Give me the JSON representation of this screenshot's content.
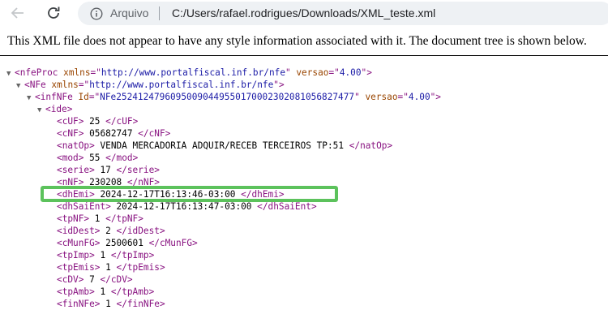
{
  "toolbar": {
    "site_label": "Arquivo",
    "url": "C:/Users/rafael.rodrigues/Downloads/XML_teste.xml"
  },
  "banner": {
    "message": "This XML file does not appear to have any style information associated with it. The document tree is shown below."
  },
  "xml": {
    "nfeProc": {
      "tag": "nfeProc",
      "xmlns": "http://www.portalfiscal.inf.br/nfe",
      "versao": "4.00"
    },
    "NFe": {
      "tag": "NFe",
      "xmlns": "http://www.portalfiscal.inf.br/nfe"
    },
    "infNFe": {
      "tag": "infNFe",
      "Id": "NFe25241247960950090449550170002302081056827477",
      "versao": "4.00"
    },
    "ide": {
      "tag": "ide"
    },
    "fields": [
      {
        "tag": "cUF",
        "value": "25"
      },
      {
        "tag": "cNF",
        "value": "05682747"
      },
      {
        "tag": "natOp",
        "value": "VENDA MERCADORIA ADQUIR/RECEB TERCEIROS TP:51"
      },
      {
        "tag": "mod",
        "value": "55"
      },
      {
        "tag": "serie",
        "value": "17"
      },
      {
        "tag": "nNF",
        "value": "230208"
      },
      {
        "tag": "dhEmi",
        "value": "2024-12-17T16:13:46-03:00"
      },
      {
        "tag": "dhSaiEnt",
        "value": "2024-12-17T16:13:47-03:00"
      },
      {
        "tag": "tpNF",
        "value": "1"
      },
      {
        "tag": "idDest",
        "value": "2"
      },
      {
        "tag": "cMunFG",
        "value": "2500601"
      },
      {
        "tag": "tpImp",
        "value": "1"
      },
      {
        "tag": "tpEmis",
        "value": "1"
      },
      {
        "tag": "cDV",
        "value": "7"
      },
      {
        "tag": "tpAmb",
        "value": "1"
      },
      {
        "tag": "finNFe",
        "value": "1"
      }
    ]
  },
  "colors": {
    "highlight": "#5cc25c",
    "tag": "#881280",
    "attr_name": "#994500",
    "attr_value": "#1a1aa6"
  }
}
